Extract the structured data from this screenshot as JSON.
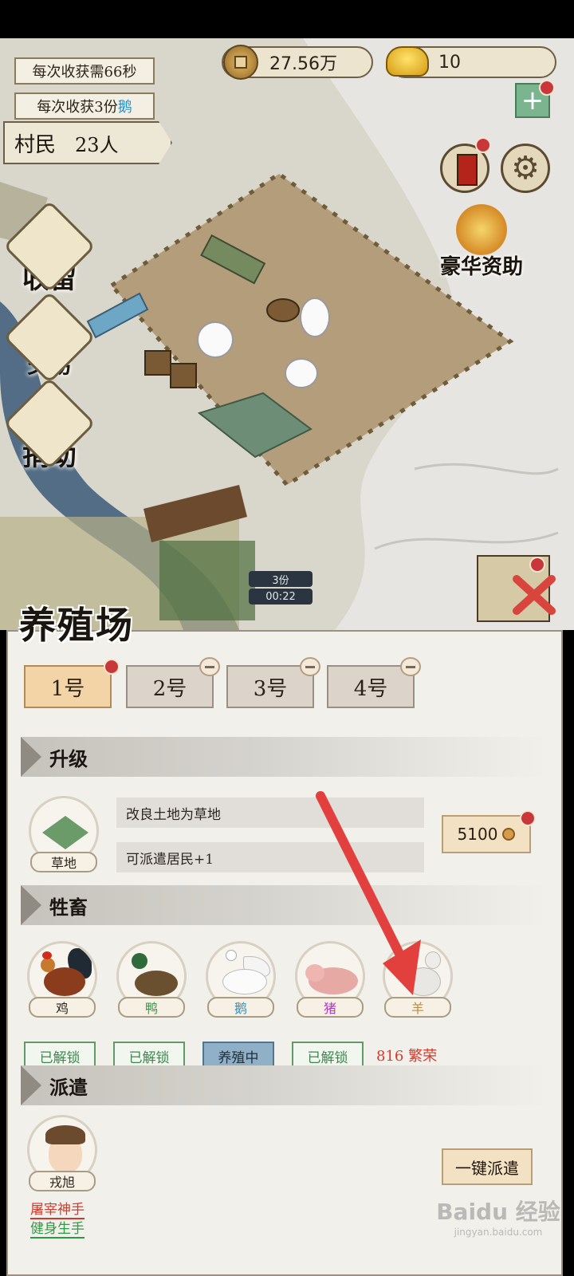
{
  "hud": {
    "harvest_interval": "每次收获需66秒",
    "harvest_amount_prefix": "每次收获3份",
    "harvest_amount_item": "鹅",
    "coins": "27.56万",
    "ingots": "10",
    "plus": "+",
    "villager_label": "村民",
    "villager_count": "23人"
  },
  "side_menu": {
    "shelter": "收留",
    "trade": "交易",
    "donate": "捐助"
  },
  "luxury": "豪华资助",
  "timer": {
    "amount": "3份",
    "time": "00:22"
  },
  "panel": {
    "title": "养殖场",
    "tabs": [
      {
        "label": "1号",
        "active": true
      },
      {
        "label": "2号",
        "locked": true
      },
      {
        "label": "3号",
        "locked": true
      },
      {
        "label": "4号",
        "locked": true
      }
    ],
    "upgrade": {
      "heading": "升级",
      "item": "草地",
      "rows": [
        "改良土地为草地",
        "可派遣居民+1"
      ],
      "cost": "5100"
    },
    "livestock": {
      "heading": "牲畜",
      "animals": [
        {
          "name": "鸡",
          "name_color": "#3b3226",
          "status": "已解锁"
        },
        {
          "name": "鸭",
          "name_color": "#2f9a45",
          "status": "已解锁"
        },
        {
          "name": "鹅",
          "name_color": "#2a8fc7",
          "status": "养殖中"
        },
        {
          "name": "猪",
          "name_color": "#b03ac7",
          "status": "已解锁"
        },
        {
          "name": "羊",
          "name_color": "#c48a2a",
          "status": "816 繁荣"
        }
      ]
    },
    "dispatch": {
      "heading": "派遣",
      "worker": "戎旭",
      "traits": [
        "屠宰神手",
        "健身生手"
      ],
      "button": "一键派遣"
    }
  },
  "watermark": {
    "brand": "Baidu 经验",
    "url": "jingyan.baidu.com"
  },
  "colors": {
    "accent_red": "#d23b2d",
    "arrow": "#e2403c",
    "unlocked_green": "#3f8650"
  }
}
